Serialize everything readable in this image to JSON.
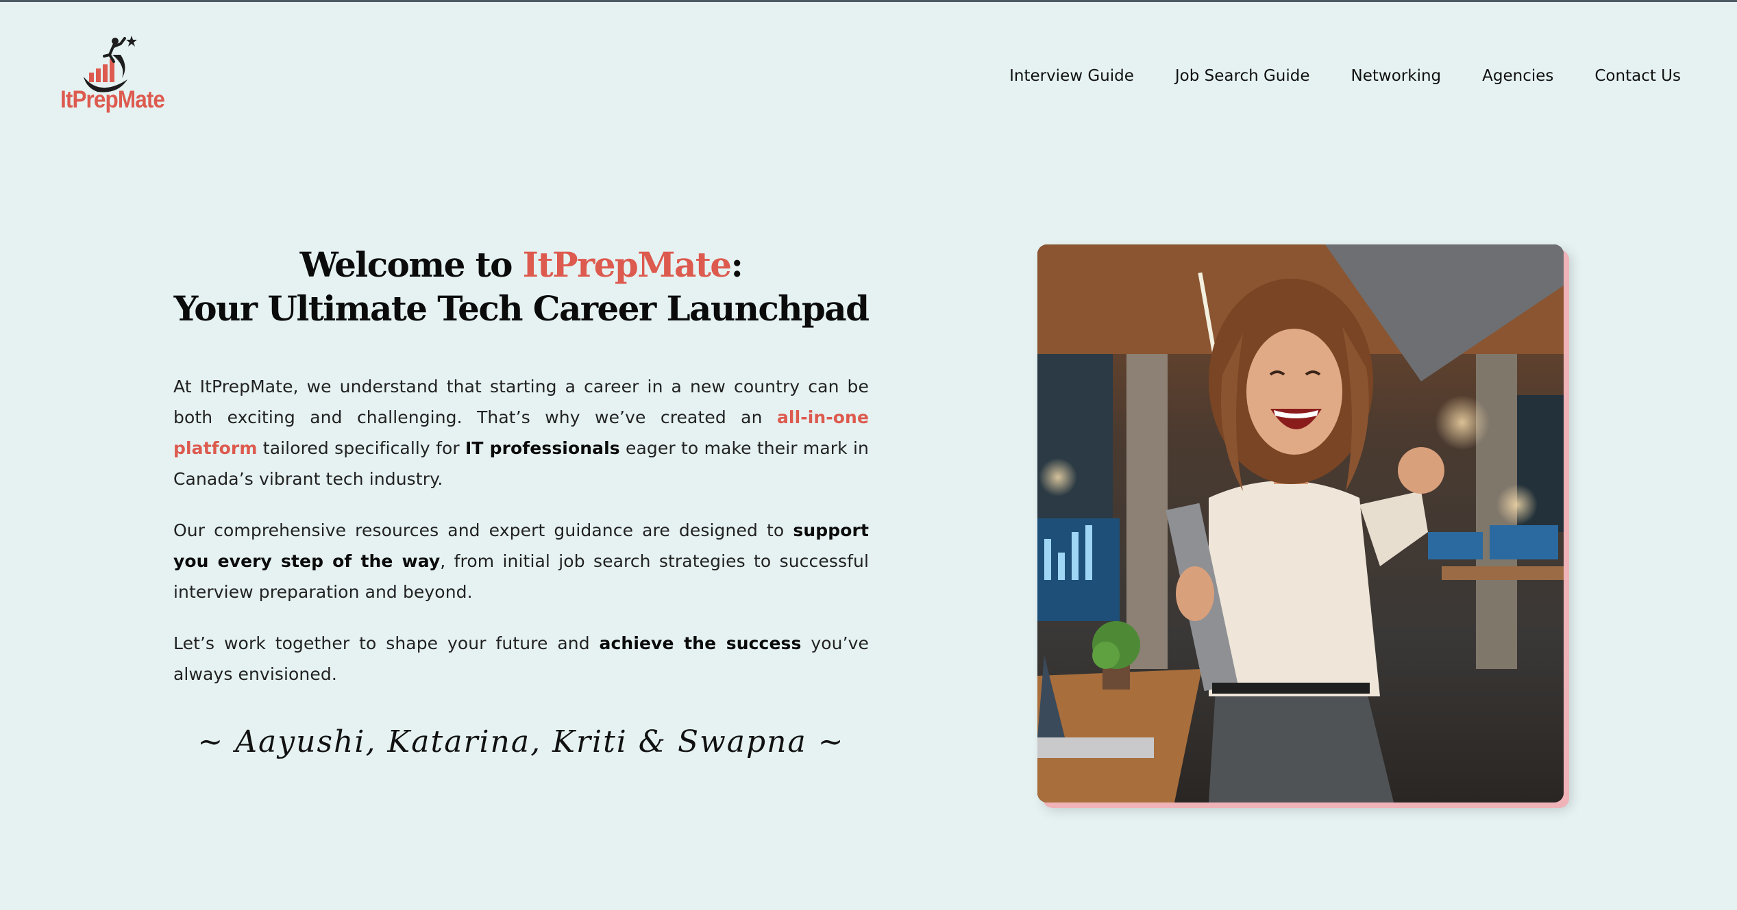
{
  "brand": {
    "name": "ItPrepMate",
    "logo_icon": "climber-chart-star-icon",
    "accent_color": "#dd5a4f"
  },
  "nav": {
    "items": [
      {
        "label": "Interview Guide"
      },
      {
        "label": "Job Search Guide"
      },
      {
        "label": "Networking"
      },
      {
        "label": "Agencies"
      },
      {
        "label": "Contact Us"
      }
    ]
  },
  "hero": {
    "title_prefix": "Welcome to ",
    "title_brand": "ItPrepMate",
    "title_colon": ":",
    "title_line2": "Your Ultimate Tech Career Launchpad",
    "p1": {
      "t1": "At ItPrepMate, we understand that starting a career in a new country can be both exciting and challenging. That’s why we’ve created an ",
      "accent": "all-in-one platform",
      "t2": " tailored specifically for ",
      "bold": "IT professionals",
      "t3": " eager to make their mark in Canada’s vibrant tech industry."
    },
    "p2": {
      "t1": "Our comprehensive resources and expert guidance are designed to ",
      "bold": "support you every step of the way",
      "t2": ", from initial job search strategies to successful interview preparation and beyond."
    },
    "p3": {
      "t1": "Let’s work together to shape your future and ",
      "bold": "achieve the success",
      "t2": " you’ve always envisioned."
    },
    "signature": "~ Aayushi, Katarina, Kriti & Swapna ~",
    "image_subject": "celebrating-woman-office-photo"
  }
}
